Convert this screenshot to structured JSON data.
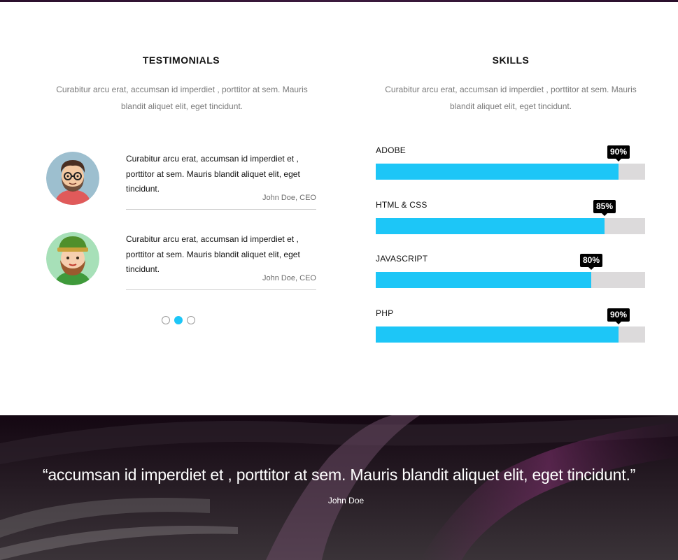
{
  "testimonials": {
    "title": "TESTIMONIALS",
    "description": "Curabitur arcu erat, accumsan id imperdiet , porttitor at sem. Mauris blandit aliquet elit, eget tincidunt.",
    "items": [
      {
        "avatar_icon": "man-with-glasses-avatar-icon",
        "quote": "Curabitur arcu erat, accumsan id imperdiet et , porttitor at sem. Mauris blandit aliquet elit, eget tincidunt.",
        "author": "John Doe, CEO"
      },
      {
        "avatar_icon": "bearded-man-with-hat-avatar-icon",
        "quote": "Curabitur arcu erat, accumsan id imperdiet et , porttitor at sem. Mauris blandit aliquet elit, eget tincidunt.",
        "author": "John Doe, CEO"
      }
    ],
    "pager": {
      "count": 3,
      "active_index": 1
    }
  },
  "skills": {
    "title": "SKILLS",
    "description": "Curabitur arcu erat, accumsan id imperdiet , porttitor at sem. Mauris blandit aliquet elit, eget tincidunt.",
    "items": [
      {
        "label": "ADOBE",
        "percent": 90,
        "percent_label": "90%"
      },
      {
        "label": "HTML & CSS",
        "percent": 85,
        "percent_label": "85%"
      },
      {
        "label": "JAVASCRIPT",
        "percent": 80,
        "percent_label": "80%"
      },
      {
        "label": "PHP",
        "percent": 90,
        "percent_label": "90%"
      }
    ]
  },
  "banner": {
    "quote": "“accumsan id imperdiet et , porttitor at sem. Mauris blandit aliquet elit, eget tincidunt.”",
    "author": "John Doe"
  },
  "colors": {
    "accent": "#1dc6f7",
    "track": "#dcdadb",
    "banner_bg": "#1b0c1b"
  }
}
